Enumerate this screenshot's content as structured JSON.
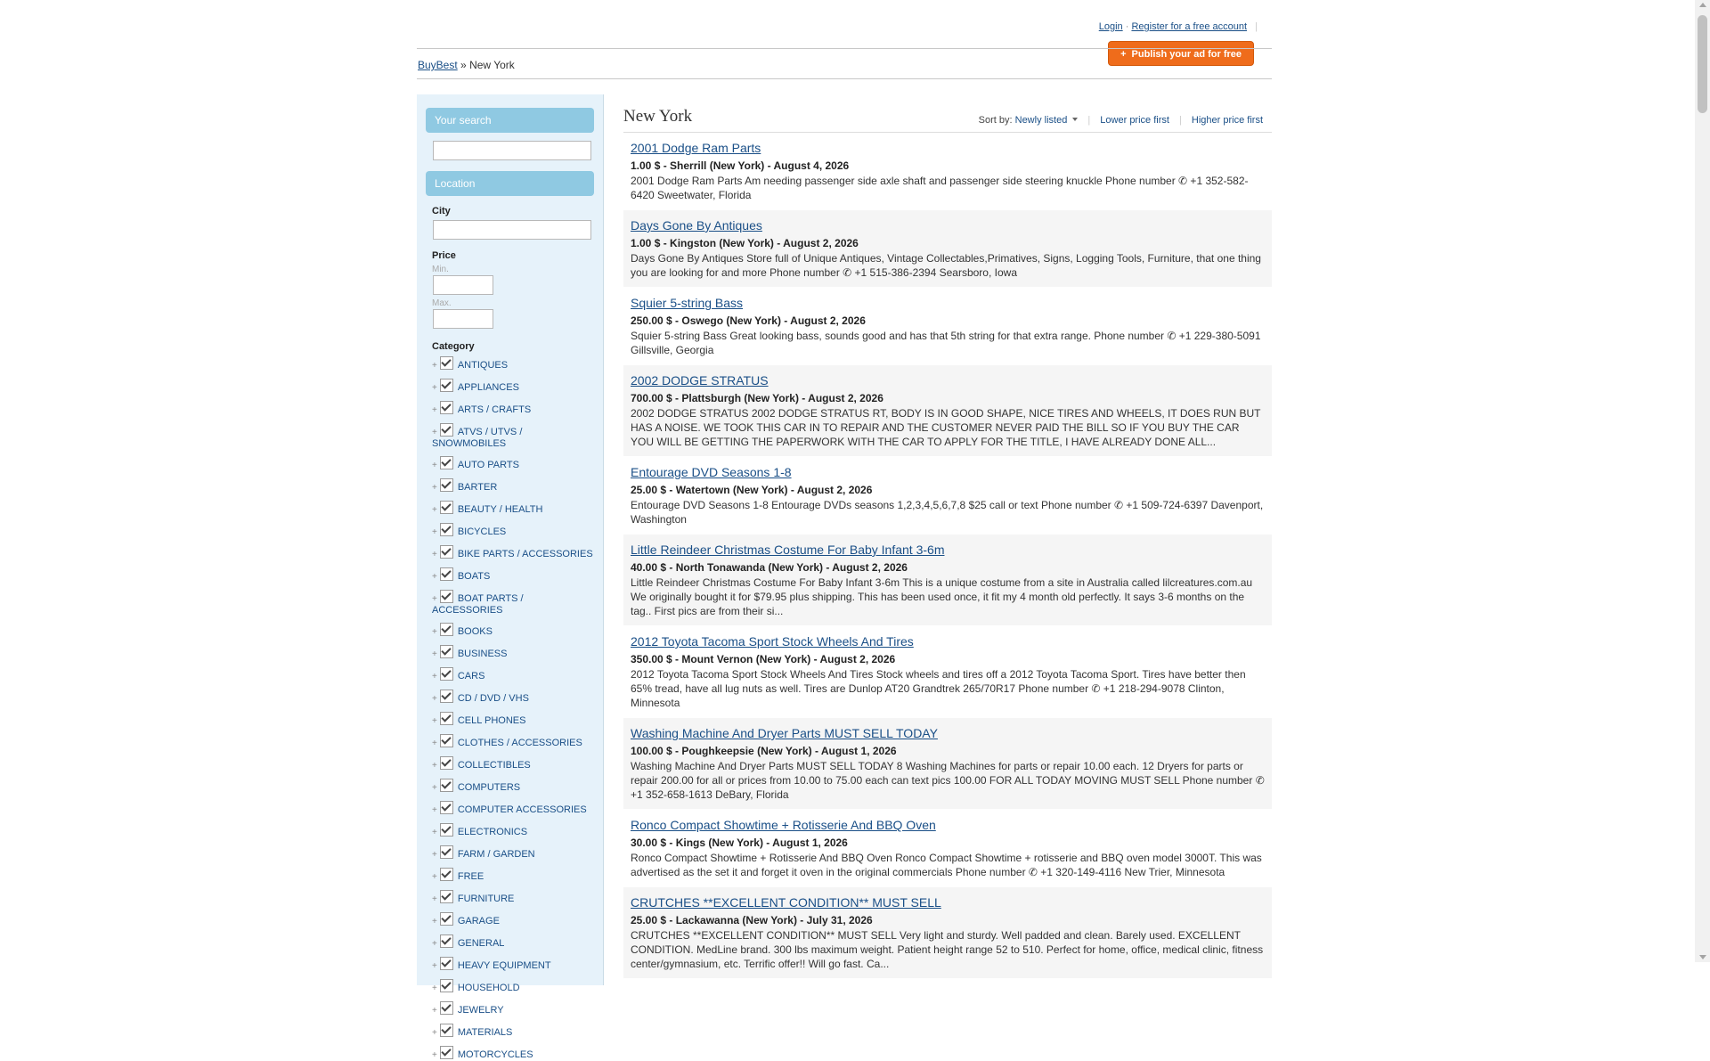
{
  "header": {
    "login_label": "Login",
    "separator": "·",
    "register_label": "Register for a free account",
    "divider": "|",
    "publish_label": "Publish your ad for free",
    "publish_icon": "+"
  },
  "breadcrumb": {
    "home": "BuyBest",
    "sep": "»",
    "current": "New York"
  },
  "sidebar": {
    "search_heading": "Your search",
    "location_heading": "Location",
    "city_label": "City",
    "price_label": "Price",
    "min_label": "Min.",
    "max_label": "Max.",
    "category_label": "Category",
    "categories": [
      "ANTIQUES",
      "APPLIANCES",
      "ARTS / CRAFTS",
      "ATVS / UTVS / SNOWMOBILES",
      "AUTO PARTS",
      "BARTER",
      "BEAUTY / HEALTH",
      "BICYCLES",
      "BIKE PARTS / ACCESSORIES",
      "BOATS",
      "BOAT PARTS / ACCESSORIES",
      "BOOKS",
      "BUSINESS",
      "CARS",
      "CD / DVD / VHS",
      "CELL PHONES",
      "CLOTHES / ACCESSORIES",
      "COLLECTIBLES",
      "COMPUTERS",
      "COMPUTER ACCESSORIES",
      "ELECTRONICS",
      "FARM / GARDEN",
      "FREE",
      "FURNITURE",
      "GARAGE",
      "GENERAL",
      "HEAVY EQUIPMENT",
      "HOUSEHOLD",
      "JEWELRY",
      "MATERIALS",
      "MOTORCYCLES"
    ]
  },
  "main": {
    "title": "New York",
    "sort_label": "Sort by:",
    "sort_current": "Newly listed",
    "sort_lower": "Lower price first",
    "sort_higher": "Higher price first",
    "listings": [
      {
        "title": "2001 Dodge Ram Parts",
        "meta": "1.00 $ - Sherrill (New York) - August 4, 2026",
        "desc": "2001 Dodge Ram Parts Am needing passenger side axle shaft and passenger side steering knuckle Phone number ✆ +1 352-582-6420 Sweetwater, Florida"
      },
      {
        "title": "Days Gone By Antiques",
        "meta": "1.00 $ - Kingston (New York) - August 2, 2026",
        "desc": "Days Gone By Antiques Store full of Unique Antiques, Vintage Collectables,Primatives, Signs, Logging Tools, Furniture, that one thing you are looking for and more Phone number ✆ +1 515-386-2394 Searsboro, Iowa"
      },
      {
        "title": "Squier 5-string Bass",
        "meta": "250.00 $ - Oswego (New York) - August 2, 2026",
        "desc": "Squier 5-string Bass Great looking bass, sounds good and has that 5th string for that extra range. Phone number ✆ +1 229-380-5091 Gillsville, Georgia"
      },
      {
        "title": "2002 DODGE STRATUS",
        "meta": "700.00 $ - Plattsburgh (New York) - August 2, 2026",
        "desc": "2002 DODGE STRATUS 2002 DODGE STRATUS RT, BODY IS IN GOOD SHAPE, NICE TIRES AND WHEELS, IT DOES RUN BUT HAS A NOISE. WE TOOK THIS CAR IN TO REPAIR AND THE CUSTOMER NEVER PAID THE BILL SO IF YOU BUY THE CAR YOU WILL BE GETTING THE PAPERWORK WITH THE CAR TO APPLY FOR THE TITLE, I HAVE ALREADY DONE ALL..."
      },
      {
        "title": "Entourage DVD Seasons 1-8",
        "meta": "25.00 $ - Watertown (New York) - August 2, 2026",
        "desc": "Entourage DVD Seasons 1-8 Entourage DVDs seasons 1,2,3,4,5,6,7,8 $25 call or text Phone number ✆ +1 509-724-6397 Davenport, Washington"
      },
      {
        "title": "Little Reindeer Christmas Costume For Baby Infant 3-6m",
        "meta": "40.00 $ - North Tonawanda (New York) - August 2, 2026",
        "desc": "Little Reindeer Christmas Costume For Baby Infant 3-6m This is a unique costume from a site in Australia called lilcreatures.com.au We originally bought it for $79.95 plus shipping. This has been used once, it fit my 4 month old perfectly. It says 3-6 months on the tag.. First pics are from their si..."
      },
      {
        "title": "2012 Toyota Tacoma Sport Stock Wheels And Tires",
        "meta": "350.00 $ - Mount Vernon (New York) - August 2, 2026",
        "desc": "2012 Toyota Tacoma Sport Stock Wheels And Tires Stock wheels and tires off a 2012 Toyota Tacoma Sport. Tires have better then 65% tread, have all lug nuts as well. Tires are Dunlop AT20 Grandtrek 265/70R17 Phone number ✆ +1 218-294-9078 Clinton, Minnesota"
      },
      {
        "title": "Washing Machine And Dryer Parts MUST SELL TODAY",
        "meta": "100.00 $ - Poughkeepsie (New York) - August 1, 2026",
        "desc": "Washing Machine And Dryer Parts MUST SELL TODAY 8 Washing Machines for parts or repair 10.00 each. 12 Dryers for parts or repair 200.00 for all or prices from 10.00 to 75.00 each can text pics 100.00 FOR ALL TODAY MOVING MUST SELL Phone number ✆ +1 352-658-1613 DeBary, Florida"
      },
      {
        "title": "Ronco Compact Showtime + Rotisserie And BBQ Oven",
        "meta": "30.00 $ - Kings (New York) - August 1, 2026",
        "desc": "Ronco Compact Showtime + Rotisserie And BBQ Oven Ronco Compact Showtime + rotisserie and BBQ oven model 3000T. This was advertised as the set it and forget it oven in the original commercials Phone number ✆ +1 320-149-4116 New Trier, Minnesota"
      },
      {
        "title": "CRUTCHES **EXCELLENT CONDITION** MUST SELL",
        "meta": "25.00 $ - Lackawanna (New York) - July 31, 2026",
        "desc": "CRUTCHES **EXCELLENT CONDITION** MUST SELL Very light and sturdy. Well padded and clean. Barely used. EXCELLENT CONDITION. MedLine brand. 300 lbs maximum weight. Patient height range 52 to 510. Perfect for home, office, medical clinic, fitness center/gymnasium, etc. Terrific offer!! Will go fast. Ca..."
      }
    ]
  }
}
